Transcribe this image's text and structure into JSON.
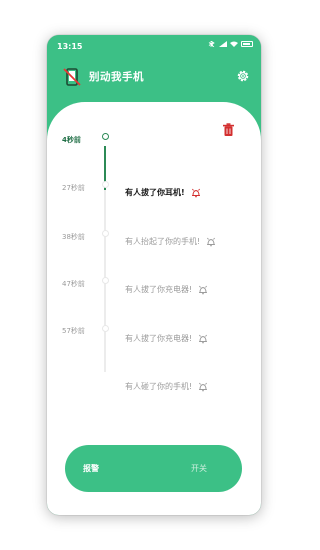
{
  "status_bar": {
    "time": "13:15",
    "battery": "100"
  },
  "header": {
    "title": "别动我手机",
    "logo_icon": "phone-no-touch-icon",
    "settings_icon": "gear-icon"
  },
  "timeline": {
    "items": [
      {
        "time": "4秒前",
        "message": "有人拔了你耳机!",
        "active": true
      },
      {
        "time": "27秒前",
        "message": "有人抬起了你的手机!",
        "active": false
      },
      {
        "time": "38秒前",
        "message": "有人拔了你充电器!",
        "active": false
      },
      {
        "time": "47秒前",
        "message": "有人拔了你充电器!",
        "active": false
      },
      {
        "time": "57秒前",
        "message": "有人碰了你的手机!",
        "active": false
      }
    ]
  },
  "toggle": {
    "left_label": "报警",
    "right_label": "开关"
  },
  "colors": {
    "primary": "#3cc086",
    "active_line": "#2c8a56",
    "alert": "#d32f2f"
  }
}
